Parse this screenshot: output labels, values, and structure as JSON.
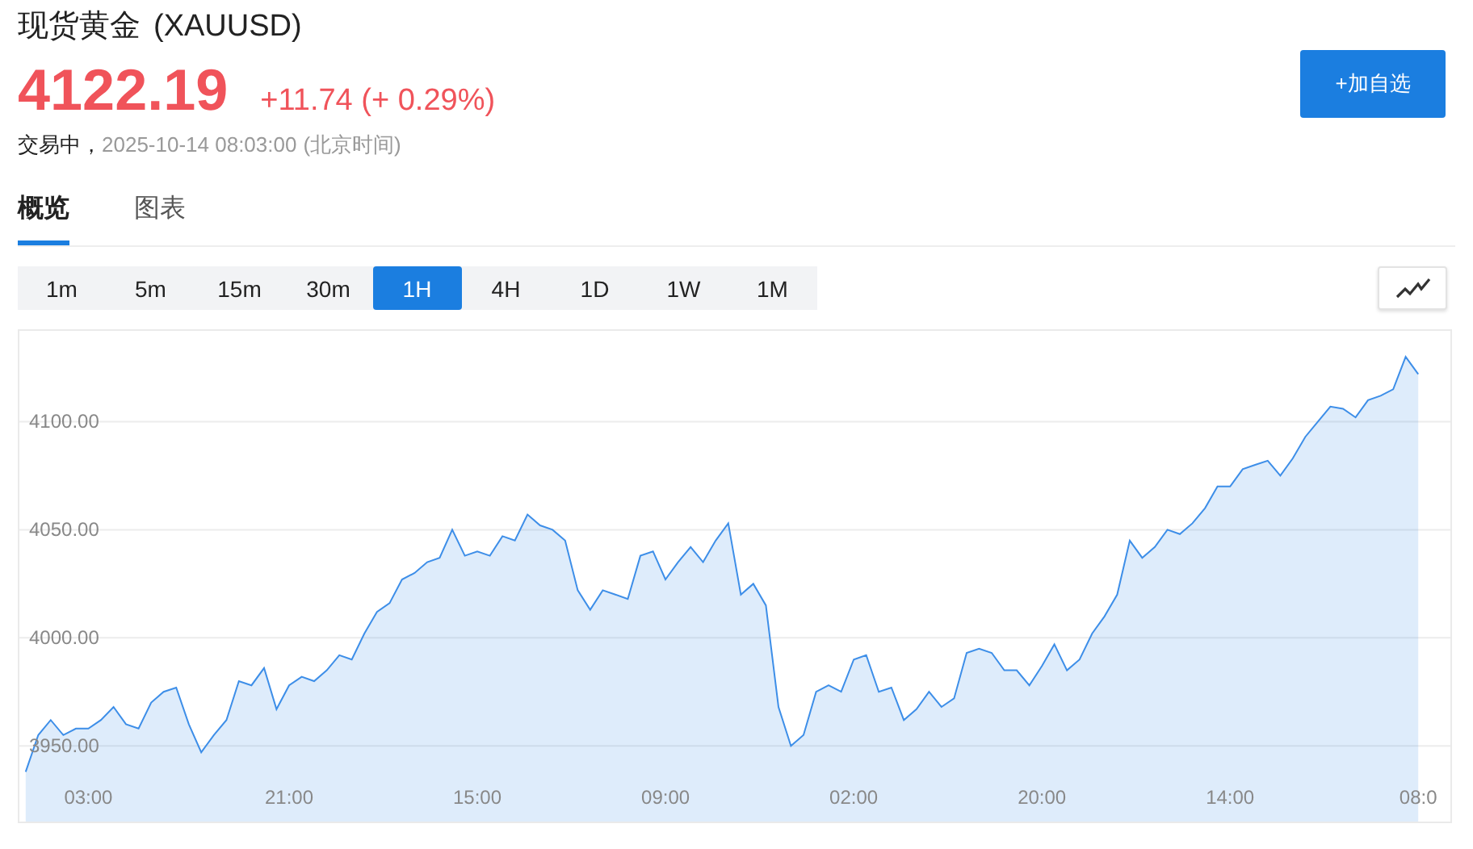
{
  "header": {
    "name": "现货黄金",
    "symbol": "(XAUUSD)",
    "price": "4122.19",
    "change": "+11.74 (+ 0.29%)",
    "status": "交易中，",
    "timestamp": "2025-10-14 08:03:00",
    "timezone": "(北京时间)",
    "watch_button": "+加自选"
  },
  "tabs": [
    {
      "label": "概览",
      "selected": true
    },
    {
      "label": "图表",
      "selected": false
    }
  ],
  "intervals": [
    {
      "label": "1m",
      "selected": false
    },
    {
      "label": "5m",
      "selected": false
    },
    {
      "label": "15m",
      "selected": false
    },
    {
      "label": "30m",
      "selected": false
    },
    {
      "label": "1H",
      "selected": true
    },
    {
      "label": "4H",
      "selected": false
    },
    {
      "label": "1D",
      "selected": false
    },
    {
      "label": "1W",
      "selected": false
    },
    {
      "label": "1M",
      "selected": false
    }
  ],
  "chart_data": {
    "type": "area",
    "categories": [
      null,
      null,
      null,
      null,
      null,
      "03:00",
      null,
      null,
      null,
      null,
      null,
      null,
      null,
      null,
      null,
      null,
      null,
      null,
      null,
      null,
      null,
      "21:00",
      null,
      null,
      null,
      null,
      null,
      null,
      null,
      null,
      null,
      null,
      null,
      null,
      null,
      null,
      "15:00",
      null,
      null,
      null,
      null,
      null,
      null,
      null,
      null,
      null,
      null,
      null,
      null,
      null,
      null,
      "09:00",
      null,
      null,
      null,
      null,
      null,
      null,
      null,
      null,
      null,
      null,
      null,
      null,
      null,
      null,
      "02:00",
      null,
      null,
      null,
      null,
      null,
      null,
      null,
      null,
      null,
      null,
      null,
      null,
      null,
      null,
      "20:00",
      null,
      null,
      null,
      null,
      null,
      null,
      null,
      null,
      null,
      null,
      null,
      null,
      null,
      null,
      "14:00",
      null,
      null,
      null,
      null,
      null,
      null,
      null,
      null,
      null,
      null,
      null,
      null,
      null,
      null,
      "08:0"
    ],
    "series": [
      {
        "color": "#3d8ee8",
        "values": [
          3938,
          3955,
          3962,
          3955,
          3958,
          3958,
          3962,
          3968,
          3960,
          3958,
          3970,
          3975,
          3977,
          3960,
          3947,
          3955,
          3962,
          3980,
          3978,
          3986,
          3967,
          3978,
          3982,
          3980,
          3985,
          3992,
          3990,
          4002,
          4012,
          4016,
          4027,
          4030,
          4035,
          4037,
          4050,
          4038,
          4040,
          4038,
          4047,
          4045,
          4057,
          4052,
          4050,
          4045,
          4022,
          4013,
          4022,
          4020,
          4018,
          4038,
          4040,
          4027,
          4035,
          4042,
          4035,
          4045,
          4053,
          4020,
          4025,
          4015,
          3968,
          3950,
          3955,
          3975,
          3978,
          3975,
          3990,
          3992,
          3975,
          3977,
          3962,
          3967,
          3975,
          3968,
          3972,
          3993,
          3995,
          3993,
          3985,
          3985,
          3978,
          3987,
          3997,
          3985,
          3990,
          4002,
          4010,
          4020,
          4045,
          4037,
          4042,
          4050,
          4048,
          4053,
          4060,
          4070,
          4070,
          4078,
          4080,
          4082,
          4075,
          4083,
          4093,
          4100,
          4107,
          4106,
          4102,
          4110,
          4112,
          4115,
          4130,
          4122
        ]
      }
    ],
    "ylim": [
      3915,
      4142
    ],
    "grid": true,
    "yticks": [
      {
        "value": 3950,
        "label": "3950.00"
      },
      {
        "value": 4000,
        "label": "4000.00"
      },
      {
        "value": 4050,
        "label": "4050.00"
      },
      {
        "value": 4100,
        "label": "4100.00"
      }
    ]
  }
}
